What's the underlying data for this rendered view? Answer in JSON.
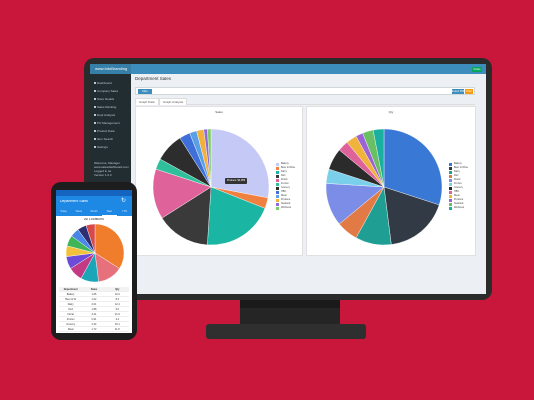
{
  "app": {
    "brand": "www.InfoBranding",
    "status": "Online",
    "page_title": "Department Sales",
    "filter_label": "Filter",
    "export_label": "Export PDF",
    "print_label": "Print",
    "tabs": [
      "Graph Data",
      "Graph Analysis"
    ],
    "sidebar_items": [
      "Dashboard",
      "Company Sales",
      "Store Details",
      "Sales Ranking",
      "Dept Analysis",
      "PO Management",
      "Product Data",
      "Item Search",
      "Settings"
    ],
    "user_info": [
      "Welcome, Manager",
      "www.salesdashboard.com",
      "Logged in as",
      "Version 1.0.3"
    ]
  },
  "colors": {
    "background": "#c8173a",
    "topbar": "#3c8dbc",
    "sidebar": "#222d32"
  },
  "left_chart": {
    "title": "Sales",
    "tooltip": "Produce: $4,859",
    "chart_data": {
      "type": "pie",
      "title": "Sales",
      "slices": [
        {
          "label": "Bakery",
          "value": 28,
          "color": "#c5c9f5"
        },
        {
          "label": "Beer & Wine",
          "value": 3,
          "color": "#f08040"
        },
        {
          "label": "Dairy",
          "value": 20,
          "color": "#1bb6a3"
        },
        {
          "label": "Deli",
          "value": 15,
          "color": "#3a3a3a"
        },
        {
          "label": "Floral",
          "value": 14,
          "color": "#e0629a"
        },
        {
          "label": "Frozen",
          "value": 3,
          "color": "#2fbf9b"
        },
        {
          "label": "Grocery",
          "value": 8,
          "color": "#2d2d2d"
        },
        {
          "label": "HBC",
          "value": 3,
          "color": "#3f6fd8"
        },
        {
          "label": "Meat",
          "value": 2,
          "color": "#5aa0e6"
        },
        {
          "label": "Produce",
          "value": 2,
          "color": "#f2b13c"
        },
        {
          "label": "Seafood",
          "value": 1,
          "color": "#8e6ad8"
        },
        {
          "label": "Wellness",
          "value": 1,
          "color": "#7ecb6b"
        }
      ]
    }
  },
  "right_chart": {
    "title": "Qty",
    "chart_data": {
      "type": "pie",
      "title": "Qty",
      "slices": [
        {
          "label": "Bakery",
          "value": 30,
          "color": "#3a78d6"
        },
        {
          "label": "Beer & Wine",
          "value": 18,
          "color": "#323a45"
        },
        {
          "label": "Dairy",
          "value": 10,
          "color": "#1f9e94"
        },
        {
          "label": "Deli",
          "value": 6,
          "color": "#e27a46"
        },
        {
          "label": "Floral",
          "value": 12,
          "color": "#7b8de6"
        },
        {
          "label": "Frozen",
          "value": 4,
          "color": "#7ad0ea"
        },
        {
          "label": "Grocery",
          "value": 6,
          "color": "#2b2b2b"
        },
        {
          "label": "HBC",
          "value": 3,
          "color": "#e0629a"
        },
        {
          "label": "Meat",
          "value": 3,
          "color": "#f0b43c"
        },
        {
          "label": "Produce",
          "value": 2,
          "color": "#9c63d6"
        },
        {
          "label": "Seafood",
          "value": 3,
          "color": "#6abf64"
        },
        {
          "label": "Wellness",
          "value": 3,
          "color": "#1ab0a0"
        }
      ]
    }
  },
  "phone": {
    "title": "Department Sales",
    "tabs": [
      "Today",
      "Week",
      "Month",
      "Year",
      "YTD"
    ],
    "section_title": "All Locations",
    "table_headers": [
      "Department",
      "Sales",
      "Qty"
    ],
    "table_rows": [
      [
        "Bakery",
        "1.66",
        "10.0"
      ],
      [
        "Beer & W",
        "1.02",
        "8.3"
      ],
      [
        "Dairy",
        "2.01",
        "12.4"
      ],
      [
        "Deli",
        "1.88",
        "9.6"
      ],
      [
        "Floral",
        "3.41",
        "21.9"
      ],
      [
        "Frozen",
        "0.91",
        "4.2"
      ],
      [
        "Grocery",
        "2.44",
        "15.1"
      ],
      [
        "Meat",
        "1.72",
        "11.8"
      ],
      [
        "Produce",
        "3.02",
        "19.3"
      ],
      [
        "Seafood",
        "2.15",
        "11.4"
      ]
    ],
    "chart_data": {
      "type": "pie",
      "title": "All Locations",
      "slices": [
        {
          "label": "Produce",
          "value": 34,
          "color": "#f07d2c"
        },
        {
          "label": "Bakery",
          "value": 14,
          "color": "#e6717d"
        },
        {
          "label": "Dairy",
          "value": 10,
          "color": "#1aa6b7"
        },
        {
          "label": "Deli",
          "value": 8,
          "color": "#c23a84"
        },
        {
          "label": "Floral",
          "value": 7,
          "color": "#6b4bd8"
        },
        {
          "label": "Frozen",
          "value": 6,
          "color": "#f2c13c"
        },
        {
          "label": "Grocery",
          "value": 6,
          "color": "#3fb55a"
        },
        {
          "label": "HBC",
          "value": 5,
          "color": "#4a86e8"
        },
        {
          "label": "Meat",
          "value": 5,
          "color": "#2e2e72"
        },
        {
          "label": "Seafood",
          "value": 5,
          "color": "#d84a4a"
        }
      ]
    }
  }
}
